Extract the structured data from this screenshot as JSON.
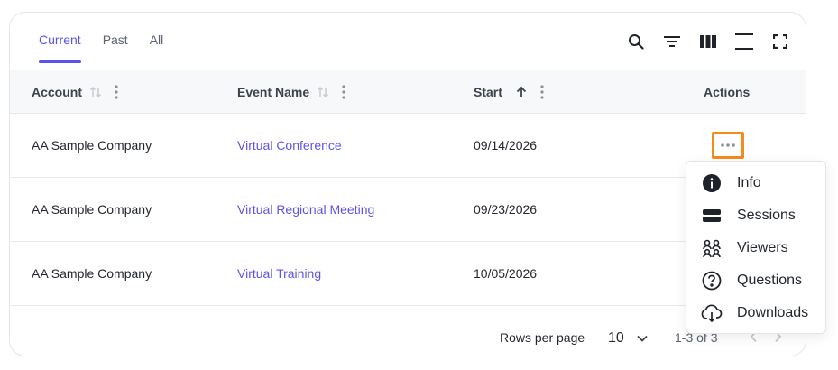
{
  "tabs": [
    {
      "label": "Current",
      "active": true
    },
    {
      "label": "Past",
      "active": false
    },
    {
      "label": "All",
      "active": false
    }
  ],
  "toolbar_icons": [
    "search-icon",
    "filter-icon",
    "columns-icon",
    "density-icon",
    "fullscreen-icon"
  ],
  "columns": {
    "account": "Account",
    "event_name": "Event Name",
    "start": "Start",
    "actions": "Actions"
  },
  "rows": [
    {
      "account": "AA Sample Company",
      "event_name": "Virtual Conference",
      "start": "09/14/2026"
    },
    {
      "account": "AA Sample Company",
      "event_name": "Virtual Regional Meeting",
      "start": "09/23/2026"
    },
    {
      "account": "AA Sample Company",
      "event_name": "Virtual Training",
      "start": "10/05/2026"
    }
  ],
  "footer": {
    "rows_per_page_label": "Rows per page",
    "rows_per_page_value": "10",
    "range": "1-3 of 3"
  },
  "actions_menu": [
    {
      "label": "Info",
      "icon": "info-icon"
    },
    {
      "label": "Sessions",
      "icon": "sessions-icon"
    },
    {
      "label": "Viewers",
      "icon": "viewers-icon"
    },
    {
      "label": "Questions",
      "icon": "question-icon"
    },
    {
      "label": "Downloads",
      "icon": "cloud-download-icon"
    }
  ],
  "colors": {
    "accent": "#5b54e8",
    "highlight": "#f58a1f"
  }
}
